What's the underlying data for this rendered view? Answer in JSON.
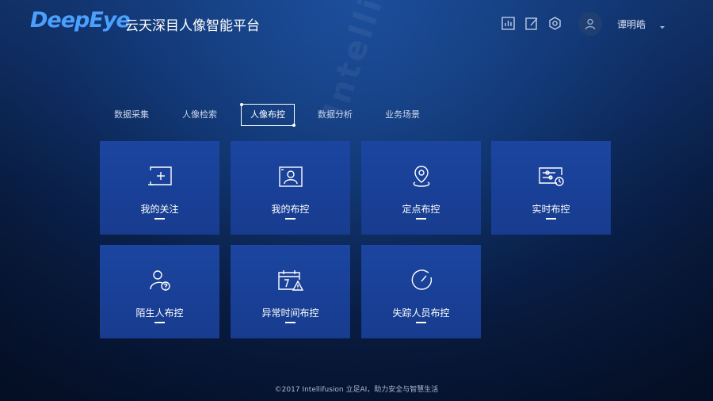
{
  "header": {
    "logo_text": "DeepEye",
    "app_title": "云天深目人像智能平台",
    "icons": [
      "chart-icon",
      "edit-icon",
      "settings-icon"
    ],
    "username": "谭明皓"
  },
  "tabs": [
    {
      "label": "数据采集",
      "active": false
    },
    {
      "label": "人像检索",
      "active": false
    },
    {
      "label": "人像布控",
      "active": true
    },
    {
      "label": "数据分析",
      "active": false
    },
    {
      "label": "业务场景",
      "active": false
    }
  ],
  "cards": [
    {
      "label": "我的关注",
      "icon": "add-frame-icon"
    },
    {
      "label": "我的布控",
      "icon": "portrait-frame-icon"
    },
    {
      "label": "定点布控",
      "icon": "location-pin-icon"
    },
    {
      "label": "实时布控",
      "icon": "sliders-clock-icon"
    },
    {
      "label": "陌生人布控",
      "icon": "user-question-icon"
    },
    {
      "label": "异常时间布控",
      "icon": "calendar-warning-icon"
    },
    {
      "label": "失踪人员布控",
      "icon": "lost-timer-icon"
    }
  ],
  "footer": {
    "text": "©2017 Intellifusion 立足AI，助力安全与智慧生活"
  },
  "colors": {
    "logo": "#4a9fff",
    "card": "#1b45a0",
    "background": "#0b2452"
  }
}
